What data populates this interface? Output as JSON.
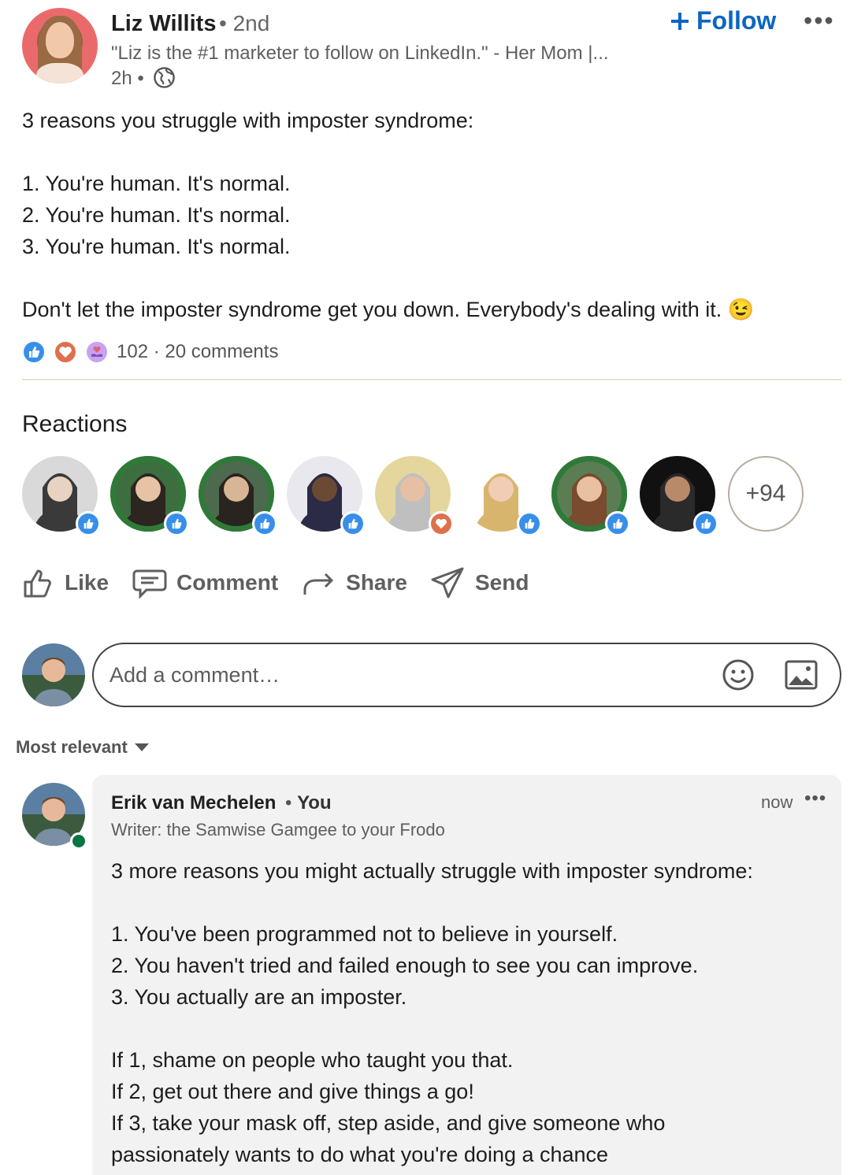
{
  "post": {
    "author_name": "Liz Willits",
    "degree": "• 2nd",
    "headline": "\"Liz is the #1 marketer to follow on LinkedIn.\" - Her Mom |...",
    "time": "2h •",
    "follow_label": "Follow",
    "follow_icon": "plus-icon",
    "more_label": "•••",
    "lines": [
      "3 reasons you struggle with imposter syndrome:",
      "",
      "1. You're human. It's normal.",
      "2. You're human. It's normal.",
      "3. You're human. It's normal.",
      "",
      "Don't let the imposter syndrome get you down. Everybody's dealing with it. 😉"
    ],
    "reaction_count": "102",
    "comment_count": "· 20 comments",
    "reaction_types": [
      "like",
      "love",
      "support"
    ]
  },
  "reactions": {
    "title": "Reactions",
    "more_label": "+94",
    "reactors": [
      {
        "badge": "like",
        "open_to_work": false
      },
      {
        "badge": "like",
        "open_to_work": true
      },
      {
        "badge": "like",
        "open_to_work": true
      },
      {
        "badge": "like",
        "open_to_work": false
      },
      {
        "badge": "love",
        "open_to_work": false
      },
      {
        "badge": "like",
        "open_to_work": false
      },
      {
        "badge": "like",
        "open_to_work": true
      },
      {
        "badge": "like",
        "open_to_work": false
      }
    ]
  },
  "actions": {
    "like": "Like",
    "comment": "Comment",
    "share": "Share",
    "send": "Send"
  },
  "composer": {
    "placeholder": "Add a comment…"
  },
  "sort": {
    "label": "Most relevant"
  },
  "comment": {
    "author_name": "Erik van Mechelen",
    "you_label": "You",
    "headline": "Writer: the Samwise Gamgee to your Frodo",
    "time": "now",
    "more_label": "•••",
    "lines": [
      "3 more reasons you might actually struggle with imposter syndrome:",
      "",
      "1. You've been programmed not to believe in yourself.",
      "2. You haven't tried and failed enough to see you can improve.",
      "3. You actually are an imposter.",
      "",
      "If 1, shame on people who taught you that.",
      "If 2, get out there and give things a go!",
      "If 3, take your mask off, step aside, and give someone who",
      "passionately wants to do what you're doing a chance"
    ]
  },
  "colors": {
    "accent": "#0a66c2",
    "like": "#378fe9",
    "love": "#df704d",
    "support": "#a872e8",
    "online": "#057642",
    "comment_bg": "#f2f2f2"
  }
}
